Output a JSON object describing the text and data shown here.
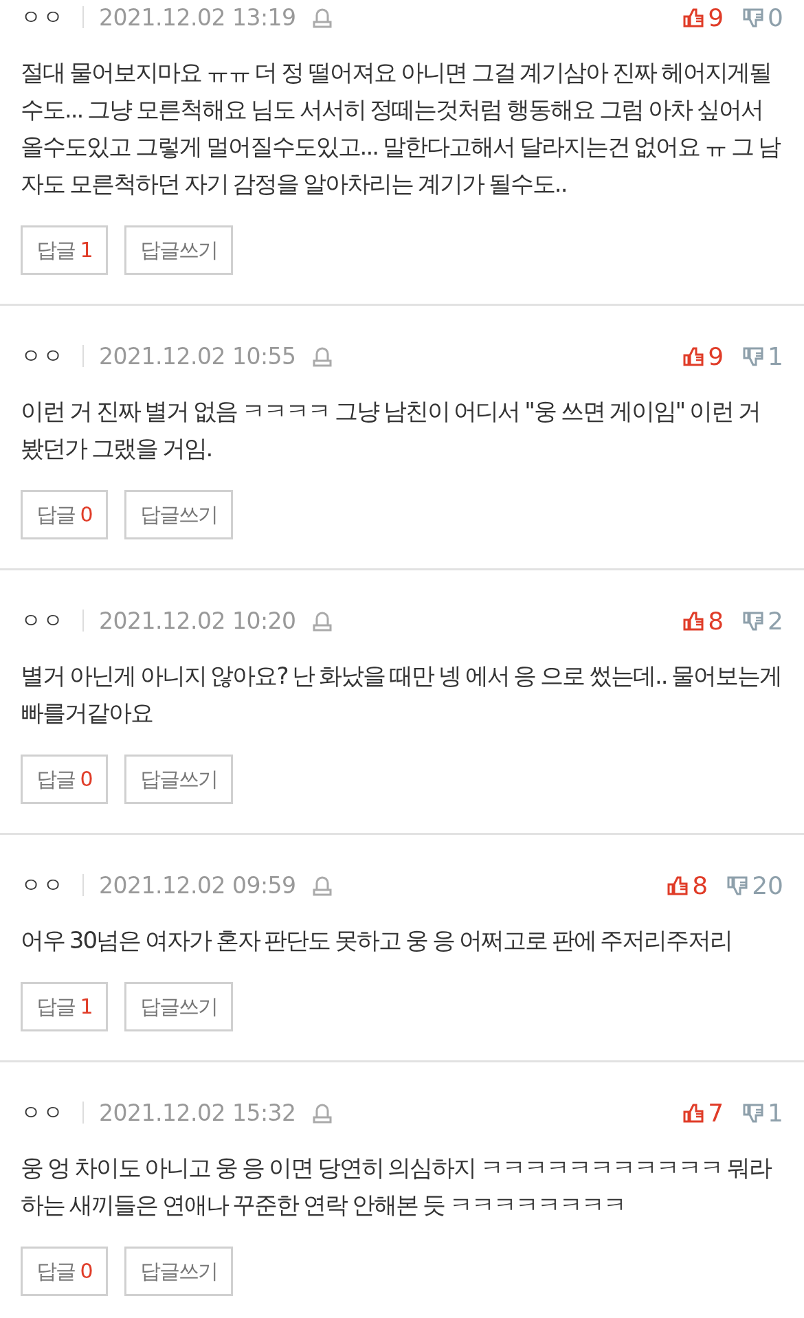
{
  "comments": [
    {
      "author": "ㅇㅇ",
      "date": "2021.12.02 13:19",
      "likes": "9",
      "dislikes": "0",
      "text": "절대 물어보지마요 ㅠㅠ 더 정 떨어져요 아니면 그걸 계기삼아 진짜 헤어지게될수도... 그냥 모른척해요 님도 서서히 정떼는것처럼 행동해요 그럼 아차 싶어서 올수도있고 그렇게 멀어질수도있고... 말한다고해서 달라지는건 없어요 ㅠ 그 남자도 모른척하던 자기 감정을 알아차리는 계기가 될수도..",
      "reply_label": "답글",
      "reply_count": "1",
      "write_label": "답글쓰기"
    },
    {
      "author": "ㅇㅇ",
      "date": "2021.12.02 10:55",
      "likes": "9",
      "dislikes": "1",
      "text": "이런 거 진짜 별거 없음 ㅋㅋㅋㅋ 그냥 남친이 어디서 \"웅 쓰면 게이임\" 이런 거 봤던가 그랬을 거임.",
      "reply_label": "답글",
      "reply_count": "0",
      "write_label": "답글쓰기"
    },
    {
      "author": "ㅇㅇ",
      "date": "2021.12.02 10:20",
      "likes": "8",
      "dislikes": "2",
      "text": "별거 아닌게 아니지 않아요? 난 화났을 때만 넹 에서 응 으로 썼는데.. 물어보는게 빠를거같아요",
      "reply_label": "답글",
      "reply_count": "0",
      "write_label": "답글쓰기"
    },
    {
      "author": "ㅇㅇ",
      "date": "2021.12.02 09:59",
      "likes": "8",
      "dislikes": "20",
      "text": "어우 30넘은 여자가 혼자 판단도 못하고 웅 응 어쩌고로 판에 주저리주저리",
      "reply_label": "답글",
      "reply_count": "1",
      "write_label": "답글쓰기"
    },
    {
      "author": "ㅇㅇ",
      "date": "2021.12.02 15:32",
      "likes": "7",
      "dislikes": "1",
      "text": "웅 엉 차이도 아니고 웅 응 이면 당연히 의심하지 ㅋㅋㅋㅋㅋㅋㅋㅋㅋㅋㅋ 뭐라하는 새끼들은 연애나 꾸준한 연락 안해본 듯 ㅋㅋㅋㅋㅋㅋㅋㅋ",
      "reply_label": "답글",
      "reply_count": "0",
      "write_label": "답글쓰기"
    }
  ]
}
